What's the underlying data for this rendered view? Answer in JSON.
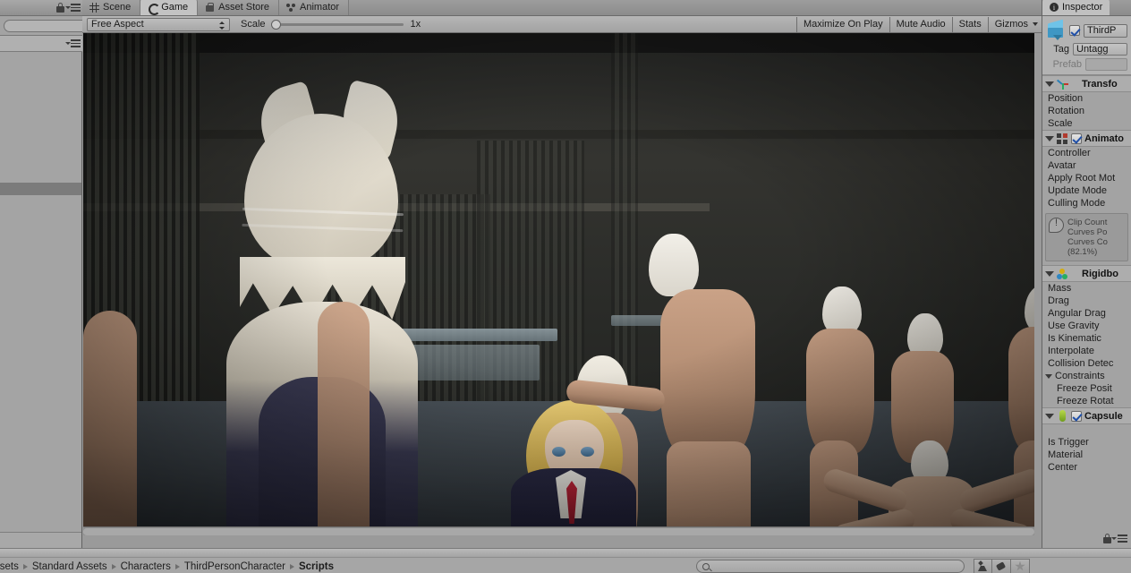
{
  "window": {
    "tabs": [
      {
        "label": "Scene",
        "icon": "grid-icon",
        "active": false
      },
      {
        "label": "Game",
        "icon": "game-icon",
        "active": true
      },
      {
        "label": "Asset Store",
        "icon": "store-icon",
        "active": false
      },
      {
        "label": "Animator",
        "icon": "animator-icon",
        "active": false
      }
    ]
  },
  "game_toolbar": {
    "aspect": "Free Aspect",
    "scale_label": "Scale",
    "scale_value": "1x",
    "scale_percent": 0,
    "maximize_on_play": "Maximize On Play",
    "mute_audio": "Mute Audio",
    "stats": "Stats",
    "gizmos": "Gizmos"
  },
  "inspector": {
    "tab_label": "Inspector",
    "tab_icon": "inspector-icon",
    "object_enabled": true,
    "object_name": "ThirdP",
    "tag_label": "Tag",
    "tag_value": "Untagg",
    "prefab_label": "Prefab",
    "prefab_value": "",
    "components": [
      {
        "title": "Transfo",
        "icon": "transform-icon",
        "has_checkbox": false,
        "enabled": false,
        "props": [
          "Position",
          "Rotation",
          "Scale"
        ]
      },
      {
        "title": "Animato",
        "icon": "animator-component-icon",
        "has_checkbox": true,
        "enabled": true,
        "props": [
          "Controller",
          "Avatar",
          "Apply Root Mot",
          "Update Mode",
          "Culling Mode"
        ],
        "warning": {
          "icon": "warning-icon",
          "lines": [
            "Clip Count",
            "Curves Po",
            "Curves Co",
            "(82.1%)"
          ]
        }
      },
      {
        "title": "Rigidbo",
        "icon": "rigidbody-icon",
        "has_checkbox": false,
        "enabled": false,
        "props": [
          "Mass",
          "Drag",
          "Angular Drag",
          "Use Gravity",
          "Is Kinematic",
          "Interpolate",
          "Collision Detec"
        ],
        "foldouts": [
          {
            "label": "Constraints",
            "children": [
              "Freeze Posit",
              "Freeze Rotat"
            ]
          }
        ]
      },
      {
        "title": "Capsule",
        "icon": "capsule-icon",
        "has_checkbox": true,
        "enabled": true,
        "props": [
          "Is Trigger",
          "Material",
          "Center"
        ]
      }
    ]
  },
  "project_bar": {
    "breadcrumb": [
      "ssets",
      "Standard Assets",
      "Characters",
      "ThirdPersonCharacter",
      "Scripts"
    ],
    "search_placeholder": "",
    "search_value": "",
    "search_icon": "search-icon",
    "buttons": [
      {
        "icon": "avatar-filter-icon"
      },
      {
        "icon": "label-filter-icon"
      },
      {
        "icon": "favorite-star-icon"
      }
    ]
  },
  "hierarchy_rail": {
    "lock_icon": "lock-icon",
    "menu_icon": "hamburger-menu-icon",
    "search_value": ""
  },
  "viewport": {
    "scene_description": "3D game scene rendered in Game view",
    "cursor_icon": "mouse-cursor"
  },
  "colors": {
    "panel_bg": "#a3a3a3",
    "tab_active": "#c3c3c3",
    "tab_inactive": "#999999",
    "border": "#6b6b6b",
    "text": "#1c1c1c",
    "text_dim": "#787878",
    "accent_blue": "#3f97c4",
    "warning": "#555555"
  }
}
